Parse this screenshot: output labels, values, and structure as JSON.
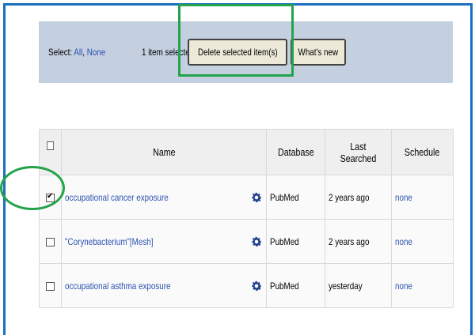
{
  "toolbar": {
    "select_label": "Select:",
    "select_all": "All",
    "select_separator": ",",
    "select_none": "None",
    "selected_count": "1 item selected",
    "delete_button": "Delete selected item(s)",
    "whats_new_button": "What's new"
  },
  "table": {
    "headers": {
      "name": "Name",
      "database": "Database",
      "last_searched": "Last Searched",
      "schedule": "Schedule"
    },
    "rows": [
      {
        "checked": true,
        "name": "occupational cancer exposure",
        "database": "PubMed",
        "last_searched": "2 years ago",
        "schedule": "none"
      },
      {
        "checked": false,
        "name": "\"Corynebacterium\"[Mesh]",
        "database": "PubMed",
        "last_searched": "2 years ago",
        "schedule": "none"
      },
      {
        "checked": false,
        "name": "occupational asthma exposure",
        "database": "PubMed",
        "last_searched": "yesterday",
        "schedule": "none"
      }
    ]
  },
  "colors": {
    "border_blue": "#1a6fbf",
    "toolbar_bg": "#c4cfe0",
    "link_blue": "#2b52b0",
    "highlight_green": "#23a34a",
    "gear_blue": "#1f3f8f"
  },
  "icons": {
    "settings": "gear-icon"
  }
}
